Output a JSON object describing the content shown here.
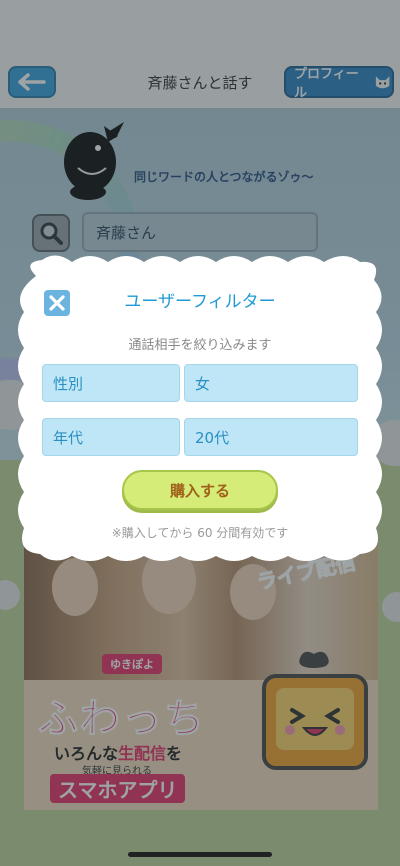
{
  "header": {
    "title": "斉藤さんと話す",
    "profile_label": "プロフィール"
  },
  "hero": {
    "tagline": "同じワードの人とつながるゾゥ～"
  },
  "search": {
    "value": "斉藤さん"
  },
  "banner": {
    "live_label": "ライブ配信",
    "tag": "ゆきぽよ",
    "title": "ふわっち",
    "line1_pre": "いろんな",
    "line1_hl": "生配信",
    "line1_post": "を",
    "line2": "気軽に見られる",
    "line3": "スマホアプリ"
  },
  "modal": {
    "title": "ユーザーフィルター",
    "subtitle": "通話相手を絞り込みます",
    "fields": [
      {
        "label": "性別",
        "value": "女"
      },
      {
        "label": "年代",
        "value": "20代"
      }
    ],
    "buy_label": "購入する",
    "note": "※購入してから 60 分間有効です"
  },
  "colors": {
    "accent": "#1f9ad6",
    "buy_button": "#d6ec79",
    "banner_pink": "#e8336a"
  }
}
